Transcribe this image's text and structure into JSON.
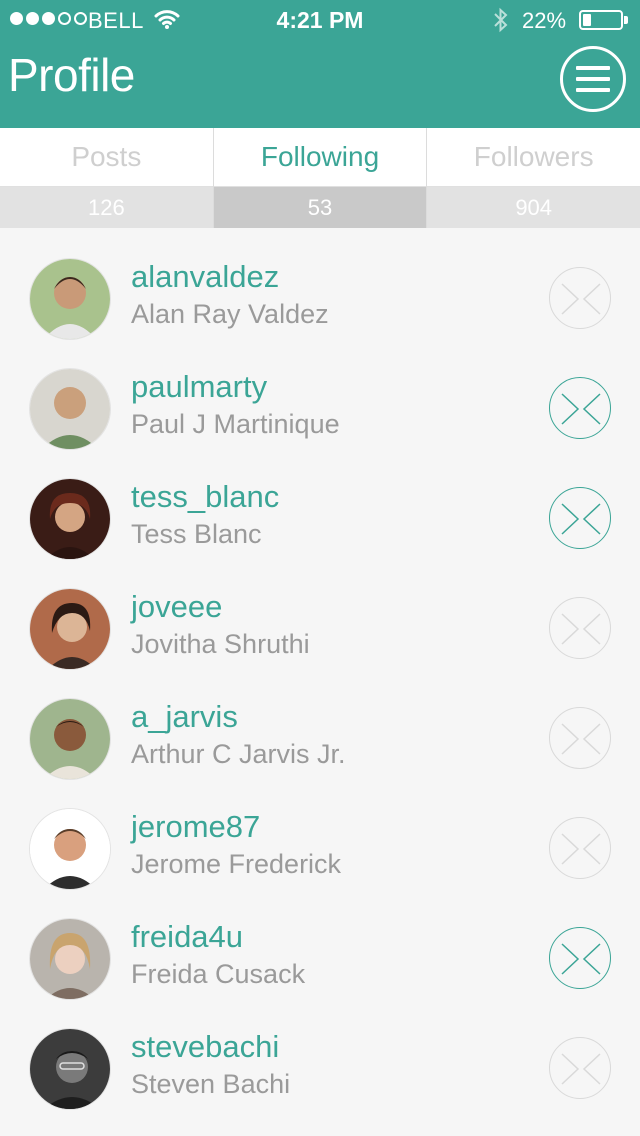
{
  "status_bar": {
    "carrier": "BELL",
    "time": "4:21 PM",
    "battery_percent": "22%",
    "battery_level": 0.22,
    "signal_bars_filled": 3,
    "signal_bars_total": 5,
    "icons": [
      "wifi-icon",
      "bluetooth-icon",
      "battery-icon"
    ]
  },
  "header": {
    "title": "Profile",
    "menu_icon": "hamburger-menu-icon"
  },
  "tabs": [
    {
      "label": "Posts",
      "count": "126",
      "active": false
    },
    {
      "label": "Following",
      "count": "53",
      "active": true
    },
    {
      "label": "Followers",
      "count": "904",
      "active": false
    }
  ],
  "following": [
    {
      "username": "alanvaldez",
      "name": "Alan Ray Valdez",
      "highlighted": false
    },
    {
      "username": "paulmarty",
      "name": "Paul J Martinique",
      "highlighted": true
    },
    {
      "username": "tess_blanc",
      "name": "Tess Blanc",
      "highlighted": true
    },
    {
      "username": "joveee",
      "name": "Jovitha Shruthi",
      "highlighted": false
    },
    {
      "username": "a_jarvis",
      "name": "Arthur C Jarvis Jr.",
      "highlighted": false
    },
    {
      "username": "jerome87",
      "name": "Jerome Frederick",
      "highlighted": false
    },
    {
      "username": "freida4u",
      "name": "Freida Cusack",
      "highlighted": true
    },
    {
      "username": "stevebachi",
      "name": "Steven Bachi",
      "highlighted": false
    }
  ],
  "colors": {
    "accent": "#3ba596",
    "background": "#f6f6f6",
    "muted": "#d9d9d9"
  }
}
